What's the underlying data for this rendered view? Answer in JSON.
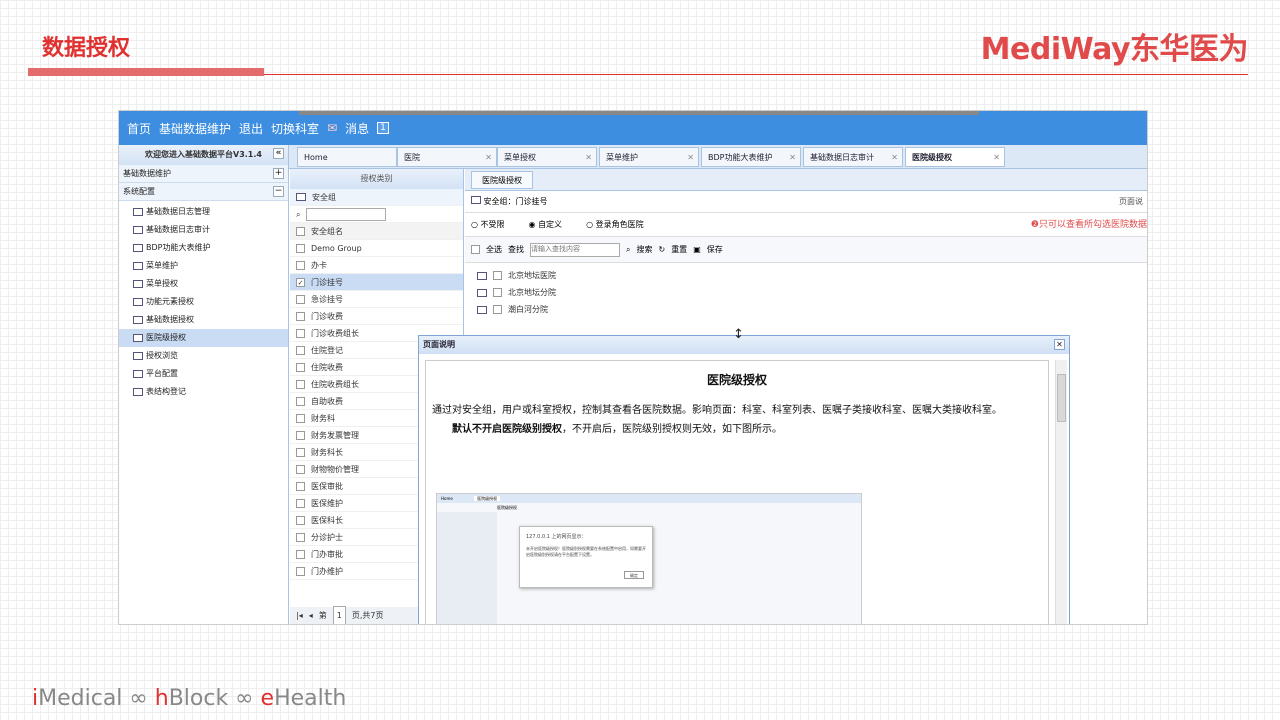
{
  "slide": {
    "title": "数据授权",
    "logo": "MediWay东华医为",
    "footer_i": "i",
    "footer_medical": "Medical ∞ ",
    "footer_h": "h",
    "footer_block": "Block ∞ ",
    "footer_e": "e",
    "footer_health": "Health"
  },
  "topbar": {
    "home": "首页",
    "basic": "基础数据维护",
    "logout": "退出",
    "switch": "切换科室",
    "msg": "消息",
    "msg_count": "1"
  },
  "left": {
    "welcome": "欢迎您进入基础数据平台V3.1.4",
    "section1": "基础数据维护",
    "section2": "系统配置",
    "items": [
      "基础数据日志管理",
      "基础数据日志审计",
      "BDP功能大表维护",
      "菜单维护",
      "菜单授权",
      "功能元素授权",
      "基础数据授权",
      "医院级授权",
      "授权浏览",
      "平台配置",
      "表结构登记"
    ]
  },
  "tabs": [
    "Home",
    "医院",
    "菜单授权",
    "菜单维护",
    "BDP功能大表维护",
    "基础数据日志审计",
    "医院级授权"
  ],
  "mid": {
    "header": "授权类别",
    "group_label": "安全组",
    "col_header": "安全组名",
    "rows": [
      "Demo Group",
      "办卡",
      "门诊挂号",
      "急诊挂号",
      "门诊收费",
      "门诊收费组长",
      "住院登记",
      "住院收费",
      "住院收费组长",
      "自助收费",
      "财务科",
      "财务发票管理",
      "财务科长",
      "财物物价管理",
      "医保审批",
      "医保维护",
      "医保科长",
      "分诊护士",
      "门办审批",
      "门办维护"
    ],
    "pager_page": "第",
    "pager_num": "1",
    "pager_total": "页,共7页"
  },
  "right": {
    "subtab": "医院级授权",
    "group_info": "安全组：门诊挂号",
    "page_help": "页面说",
    "opt1": "不受限",
    "opt2": "自定义",
    "opt3": "登录角色医院",
    "warn": "❷只可以查看所勾选医院数据",
    "select_all": "全选",
    "search_label": "查找",
    "search_placeholder": "请输入查找内容",
    "btn_search": "搜索",
    "btn_reset": "重置",
    "btn_save": "保存",
    "hospitals": [
      "北京地坛医院",
      "北京地坛分院",
      "潮白河分院"
    ]
  },
  "dialog": {
    "title": "页面说明",
    "heading": "医院级授权",
    "para1": "通过对安全组，用户或科室授权，控制其查看各医院数据。影响页面：科室、科室列表、医嘱子类接收科室、医嘱大类接收科室。",
    "para2_bold": "默认不开启医院级别授权",
    "para2_rest": "，不开启后，医院级别授权则无效，如下图所示。",
    "mini_home": "Home",
    "mini_tab": "医院级授权",
    "mini_subtab": "医院级授权",
    "mini_title": "127.0.0.1 上的网页显示：",
    "mini_text": "未开启医院级授权！医院级别授权需要在系统配置中启用，如需要开启医院级别授权请在平台配置下设置。",
    "mini_ok": "确定"
  }
}
